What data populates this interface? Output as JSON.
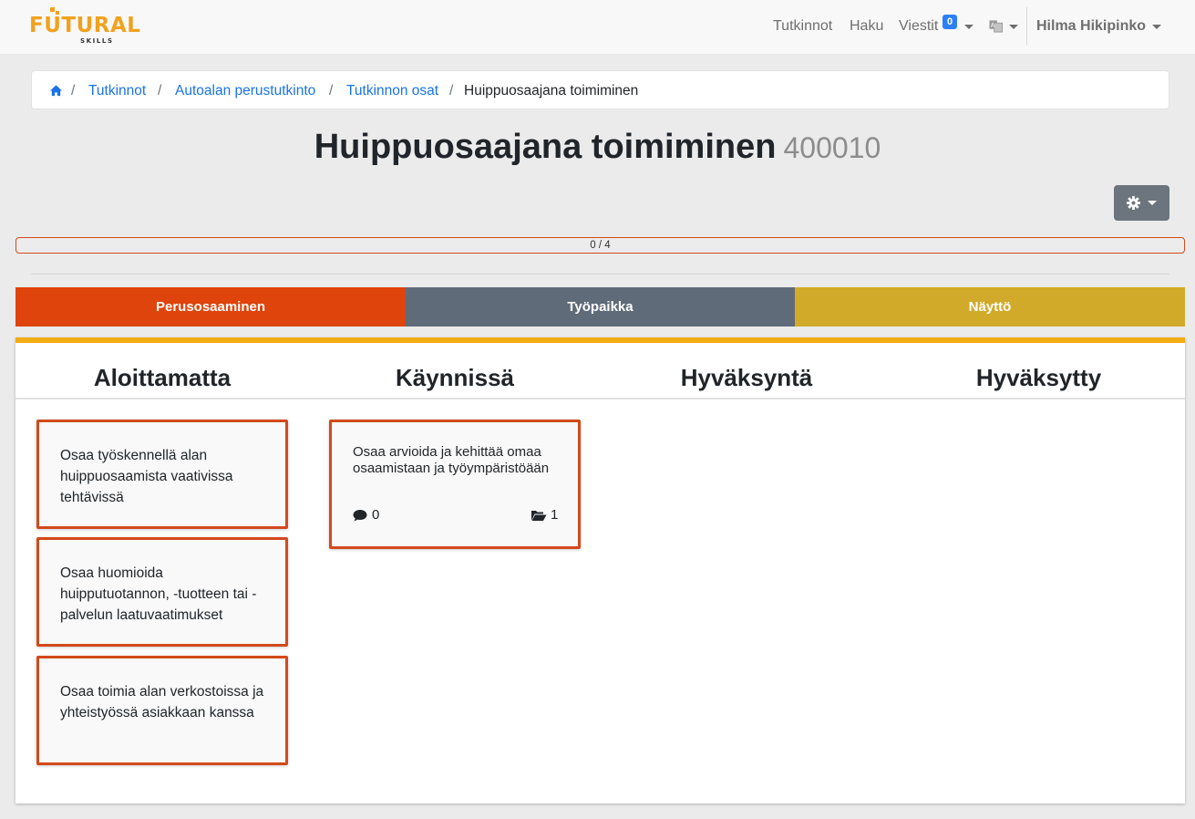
{
  "brand": {
    "name": "FUTURAL",
    "sub": "SKILLS",
    "accent": "#f0a21d"
  },
  "nav": {
    "tutkinnot": "Tutkinnot",
    "haku": "Haku",
    "viestit": "Viestit",
    "viestit_badge": "0",
    "user": "Hilma Hikipinko"
  },
  "breadcrumb": {
    "items": [
      "Tutkinnot",
      "Autoalan perustutkinto",
      "Tutkinnon osat"
    ],
    "active": "Huippuosaajana toimiminen",
    "separator": "/"
  },
  "title": {
    "main": "Huippuosaajana toimiminen",
    "code": "400010"
  },
  "progress": {
    "label": "0 / 4",
    "fraction": 0,
    "color": "#d24a1b"
  },
  "phases": [
    {
      "label": "Perusosaaminen",
      "color": "#de440b"
    },
    {
      "label": "Työpaikka",
      "color": "#606b7a"
    },
    {
      "label": "Näyttö",
      "color": "#d2aa2a"
    }
  ],
  "columns": [
    "Aloittamatta",
    "Käynnissä",
    "Hyväksyntä",
    "Hyväksytty"
  ],
  "cards": {
    "not_started": [
      "Osaa työskennellä alan huippuosaamista vaativissa tehtävissä",
      "Osaa huomioida huipputuotannon, -tuotteen tai -palvelun laatuvaatimukset",
      "Osaa toimia alan verkostoissa ja yhteistyössä asiakkaan kanssa"
    ],
    "in_progress": [
      {
        "text": "Osaa arvioida ja kehittää omaa osaamistaan ja työympäristöään",
        "comments": "0",
        "files": "1"
      }
    ]
  },
  "icons": [
    "home-icon",
    "language-icon",
    "gear-icon",
    "comment-icon",
    "folder-open-icon"
  ]
}
